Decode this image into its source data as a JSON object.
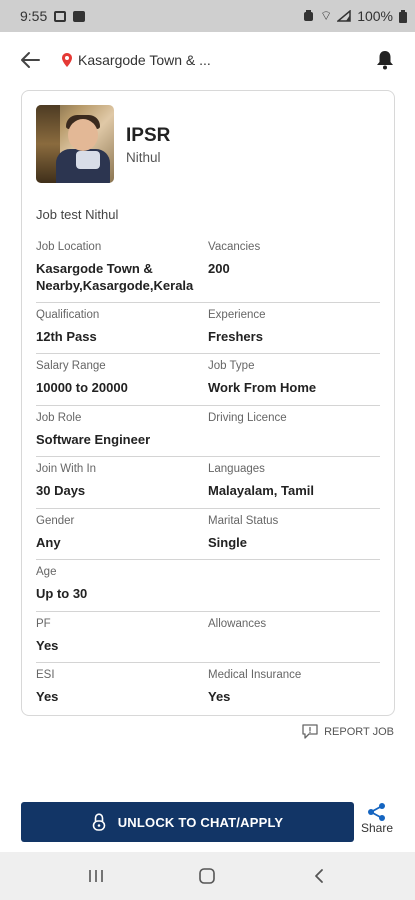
{
  "status_bar": {
    "time": "9:55",
    "battery": "100%"
  },
  "header": {
    "location": "Kasargode Town & ...",
    "icons": [
      "back-arrow-icon",
      "location-pin-icon",
      "bell-icon"
    ]
  },
  "company": {
    "name": "IPSR",
    "contact": "Nithul"
  },
  "job_title": "Job test Nithul",
  "fields": [
    {
      "left": {
        "label": "Job Location",
        "value": "Kasargode Town & Nearby,Kasargode,Kerala"
      },
      "right": {
        "label": "Vacancies",
        "value": "200"
      }
    },
    {
      "left": {
        "label": "Qualification",
        "value": "12th Pass"
      },
      "right": {
        "label": "Experience",
        "value": "Freshers"
      }
    },
    {
      "left": {
        "label": "Salary Range",
        "value": "10000 to 20000"
      },
      "right": {
        "label": "Job Type",
        "value": "Work From Home"
      }
    },
    {
      "left": {
        "label": "Job Role",
        "value": "Software Engineer"
      },
      "right": {
        "label": "Driving Licence",
        "value": ""
      }
    },
    {
      "left": {
        "label": "Join With In",
        "value": "30 Days"
      },
      "right": {
        "label": "Languages",
        "value": "Malayalam, Tamil"
      }
    },
    {
      "left": {
        "label": "Gender",
        "value": "Any"
      },
      "right": {
        "label": "Marital Status",
        "value": "Single"
      }
    },
    {
      "left": {
        "label": "Age",
        "value": "Up to 30"
      },
      "right": {
        "label": "",
        "value": ""
      }
    },
    {
      "left": {
        "label": "PF",
        "value": "Yes"
      },
      "right": {
        "label": "Allowances",
        "value": ""
      }
    },
    {
      "left": {
        "label": "ESI",
        "value": "Yes"
      },
      "right": {
        "label": "Medical Insurance",
        "value": "Yes"
      }
    }
  ],
  "report_label": "REPORT JOB",
  "unlock_label": "UNLOCK TO CHAT/APPLY",
  "share_label": "Share",
  "colors": {
    "primary": "#123566",
    "pin": "#e53935",
    "status_bar": "#cfcfcf"
  }
}
